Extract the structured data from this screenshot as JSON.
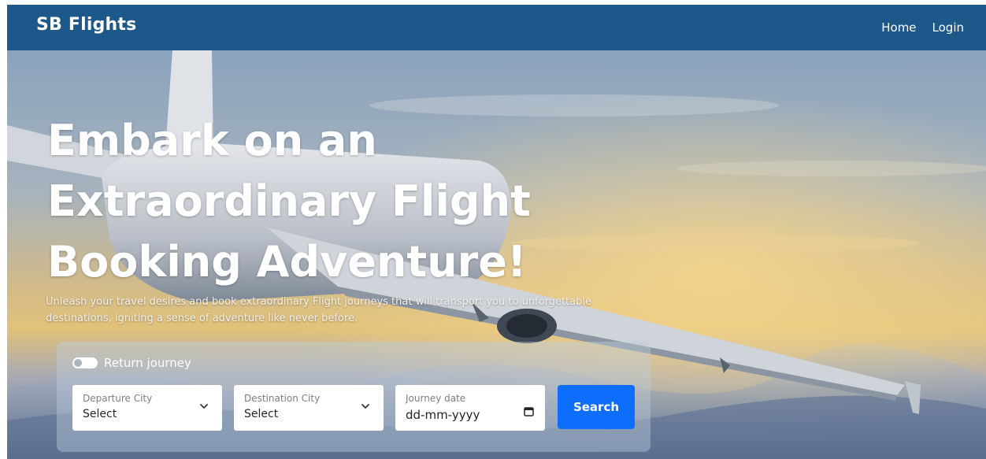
{
  "navbar": {
    "brand": "SB Flights",
    "links": [
      "Home",
      "Login"
    ],
    "bg_color": "#1c588a"
  },
  "hero": {
    "headline": "Embark on an\nExtraordinary Flight\nBooking Adventure!",
    "subtext": "Unleash your travel desires and book extraordinary Flight journeys that will transport you to unforgettable destinations, igniting a sense of adventure like never before."
  },
  "search": {
    "return_toggle_label": "Return journey",
    "return_toggle_on": false,
    "departure": {
      "label": "Departure City",
      "value": "Select",
      "icon": "chevron-down-icon"
    },
    "destination": {
      "label": "Destination City",
      "value": "Select",
      "icon": "chevron-down-icon"
    },
    "date": {
      "label": "Journey date",
      "placeholder": "dd-mm-yyyy",
      "icon": "calendar-icon"
    },
    "button_label": "Search",
    "button_color": "#0d6efd"
  }
}
